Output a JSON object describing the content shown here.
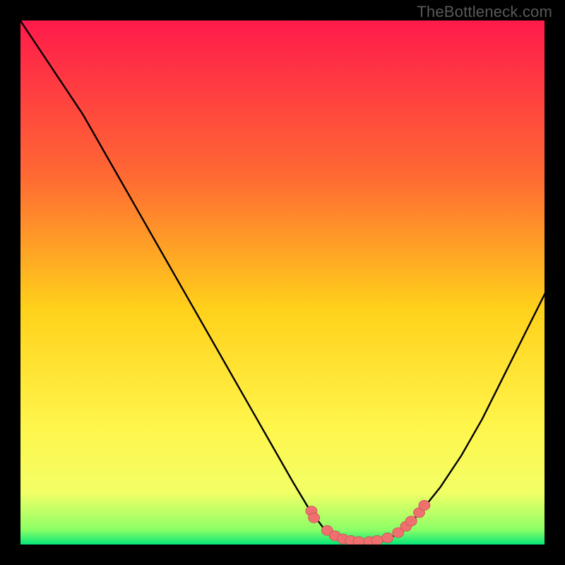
{
  "watermark": "TheBottleneck.com",
  "colors": {
    "frame": "#000000",
    "axis_border": "#000000",
    "gradient_top": "#ff1a4b",
    "gradient_mid1": "#ff6a33",
    "gradient_mid2": "#ffd11a",
    "gradient_mid3": "#fff64d",
    "gradient_bottom_yellow": "#f2ff66",
    "gradient_green": "#00e67a",
    "curve": "#000000",
    "dot_fill": "#f07070",
    "dot_stroke": "#c25454"
  },
  "chart_data": {
    "type": "line",
    "title": "",
    "xlabel": "",
    "ylabel": "",
    "xlim": [
      0,
      100
    ],
    "ylim": [
      0,
      100
    ],
    "curve": {
      "x": [
        0,
        4,
        8,
        12,
        16,
        20,
        24,
        28,
        32,
        36,
        40,
        44,
        48,
        52,
        55,
        58,
        61,
        64,
        67,
        70,
        73,
        76,
        80,
        84,
        88,
        92,
        96,
        100
      ],
      "y": [
        100,
        94,
        88,
        82,
        75,
        68,
        61,
        54,
        47,
        40,
        33,
        26,
        19,
        12,
        7,
        3,
        1,
        0.5,
        0.5,
        1,
        3,
        6,
        11,
        17,
        24,
        32,
        40,
        48
      ]
    },
    "highlight_points": {
      "x": [
        55.5,
        56.0,
        58.5,
        60.0,
        61.5,
        63.0,
        64.5,
        66.5,
        68.0,
        70.0,
        72.0,
        73.5,
        74.5,
        76.0,
        77.0
      ],
      "y": [
        6.5,
        5.2,
        2.8,
        1.8,
        1.2,
        0.9,
        0.7,
        0.7,
        0.9,
        1.4,
        2.4,
        3.6,
        4.6,
        6.2,
        7.6
      ]
    }
  }
}
